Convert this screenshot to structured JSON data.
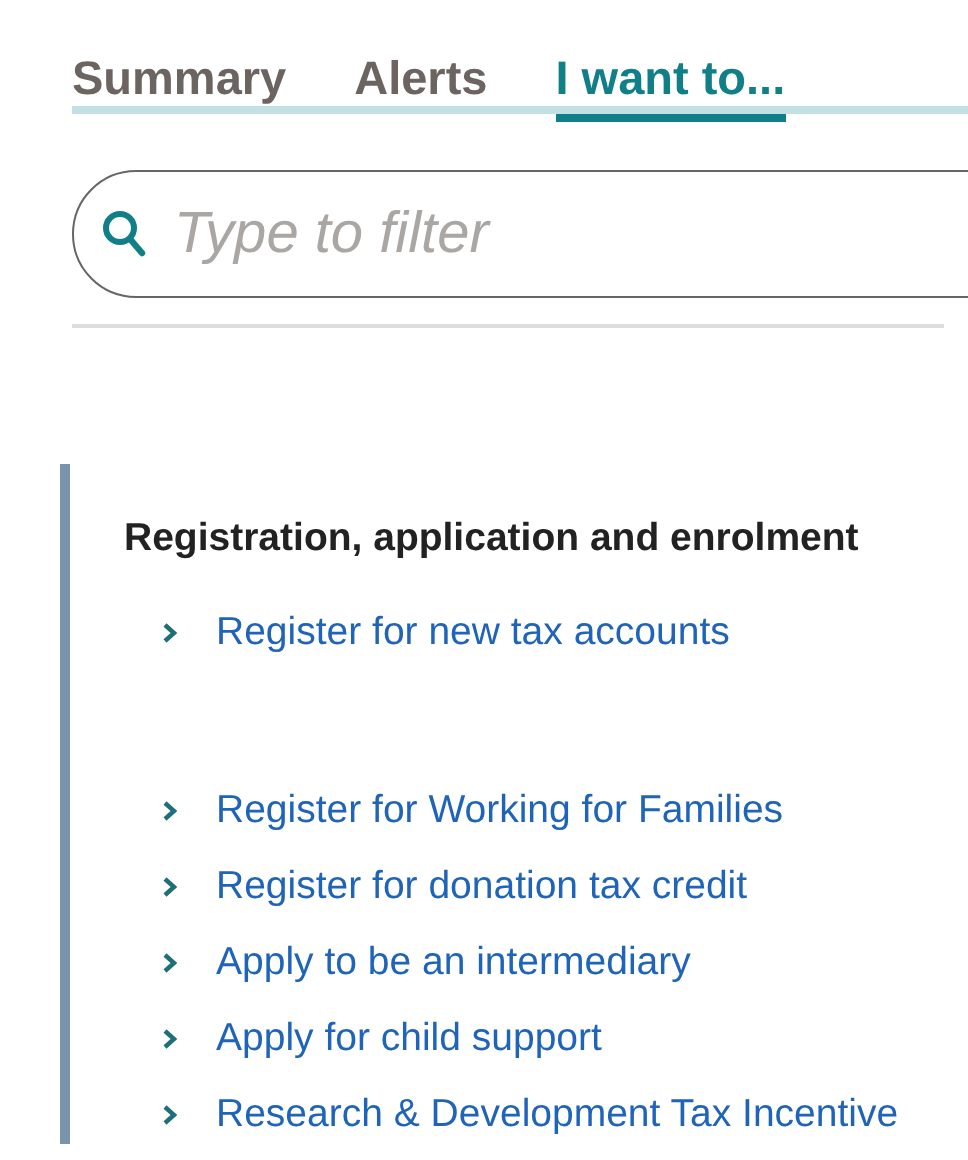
{
  "tabs": [
    {
      "label": "Summary",
      "selected": false
    },
    {
      "label": "Alerts",
      "selected": false
    },
    {
      "label": "I want to...",
      "selected": true
    }
  ],
  "search": {
    "placeholder": "Type to filter"
  },
  "section": {
    "heading": "Registration, application and enrolment",
    "link_groups": [
      {
        "links": [
          "Register for new tax accounts"
        ]
      },
      {
        "links": [
          "Register for Working for Families",
          "Register for donation tax credit",
          "Apply to be an intermediary",
          "Apply for child support",
          "Research & Development Tax Incentive"
        ]
      }
    ]
  }
}
